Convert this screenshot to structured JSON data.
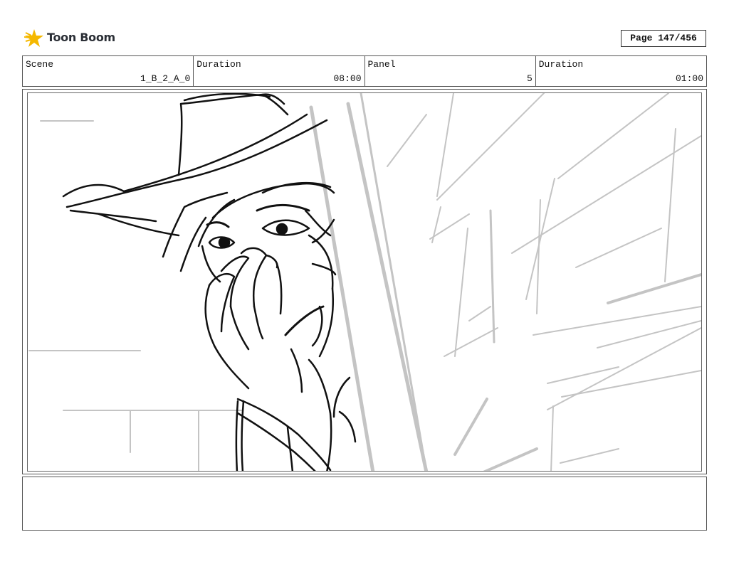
{
  "header": {
    "logo_text": "Toon Boom",
    "page_label": "Page 147/456"
  },
  "info": {
    "scene_label": "Scene",
    "scene_value": "1_B_2_A_0",
    "duration_label": "Duration",
    "duration_value": "08:00",
    "panel_label": "Panel",
    "panel_value": "5",
    "panel_duration_label": "Duration",
    "panel_duration_value": "01:00"
  },
  "colors": {
    "logo_accent": "#f5b800",
    "sketch_dark": "#111111",
    "sketch_light": "#c4c4c4"
  },
  "notes": {
    "text": ""
  }
}
